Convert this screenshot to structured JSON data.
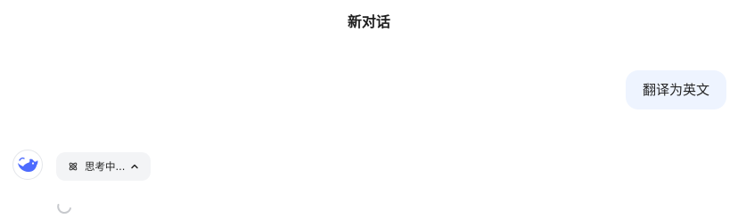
{
  "header": {
    "title": "新对话"
  },
  "conversation": {
    "user_message": "翻译为英文",
    "assistant": {
      "avatar_icon": "deepseek-whale-icon",
      "thinking_label": "思考中...",
      "thinking_icon": "atom-icon",
      "toggle_icon": "chevron-up-icon",
      "loading_icon": "spinner-icon"
    }
  },
  "colors": {
    "user_bubble_bg": "#eef4ff",
    "brand_blue": "#4d6bfe",
    "chip_bg": "#f3f4f6"
  }
}
